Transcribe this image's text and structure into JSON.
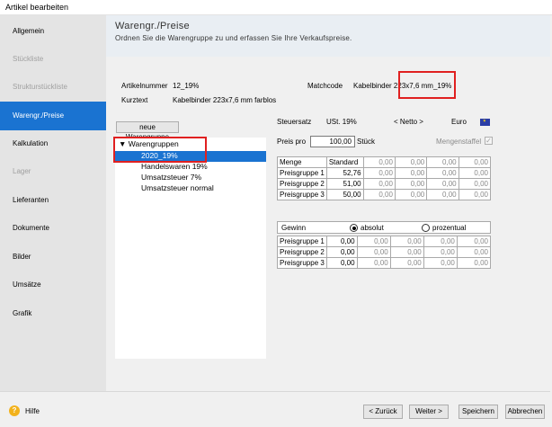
{
  "window": {
    "title": "Artikel bearbeiten"
  },
  "sidebar": {
    "items": [
      {
        "label": "Allgemein",
        "state": "normal"
      },
      {
        "label": "Stückliste",
        "state": "disabled"
      },
      {
        "label": "Strukturstückliste",
        "state": "disabled"
      },
      {
        "label": "Warengr./Preise",
        "state": "active"
      },
      {
        "label": "Kalkulation",
        "state": "normal"
      },
      {
        "label": "Lager",
        "state": "disabled"
      },
      {
        "label": "Lieferanten",
        "state": "normal"
      },
      {
        "label": "Dokumente",
        "state": "normal"
      },
      {
        "label": "Bilder",
        "state": "normal"
      },
      {
        "label": "Umsätze",
        "state": "normal"
      },
      {
        "label": "Grafik",
        "state": "normal"
      }
    ]
  },
  "header": {
    "title": "Warengr./Preise",
    "subtitle": "Ordnen Sie die Warengruppe zu und erfassen Sie Ihre Verkaufspreise."
  },
  "article": {
    "number_label": "Artikelnummer",
    "number_value": "12_19%",
    "matchcode_label": "Matchcode",
    "matchcode_value": "Kabelbinder 223x7,6 mm_19%",
    "short_label": "Kurztext",
    "short_value": "Kabelbinder 223x7,6 mm farblos"
  },
  "tree": {
    "new_button": "neue Warengruppe",
    "root_label": "Warengruppen",
    "items": [
      "2020_19%",
      "Handelswaren 19%",
      "Umsatzsteuer 7%",
      "Umsatzsteuer normal"
    ]
  },
  "tax": {
    "label": "Steuersatz",
    "value": "USt. 19%",
    "netto": "< Netto >",
    "currency": "Euro"
  },
  "price_per": {
    "label": "Preis pro",
    "value": "100,00",
    "unit": "Stück",
    "mengenstaffel_label": "Mengenstaffel"
  },
  "price_table": {
    "headers": [
      "Menge",
      "Standard",
      "0,00",
      "0,00",
      "0,00",
      "0,00"
    ],
    "rows": [
      {
        "label": "Preisgruppe 1",
        "values": [
          "52,76",
          "0,00",
          "0,00",
          "0,00",
          "0,00"
        ]
      },
      {
        "label": "Preisgruppe 2",
        "values": [
          "51,00",
          "0,00",
          "0,00",
          "0,00",
          "0,00"
        ]
      },
      {
        "label": "Preisgruppe 3",
        "values": [
          "50,00",
          "0,00",
          "0,00",
          "0,00",
          "0,00"
        ]
      }
    ]
  },
  "profit_table": {
    "label": "Gewinn",
    "absolute_label": "absolut",
    "percent_label": "prozentual",
    "rows": [
      {
        "label": "Preisgruppe 1",
        "values": [
          "0,00",
          "0,00",
          "0,00",
          "0,00",
          "0,00"
        ]
      },
      {
        "label": "Preisgruppe 2",
        "values": [
          "0,00",
          "0,00",
          "0,00",
          "0,00",
          "0,00"
        ]
      },
      {
        "label": "Preisgruppe 3",
        "values": [
          "0,00",
          "0,00",
          "0,00",
          "0,00",
          "0,00"
        ]
      }
    ]
  },
  "footer": {
    "help": "Hilfe",
    "back": "< Zurück",
    "next": "Weiter >",
    "save": "Speichern",
    "cancel": "Abbrechen"
  },
  "colors": {
    "accent": "#1a73d1",
    "highlight": "#e02020"
  }
}
